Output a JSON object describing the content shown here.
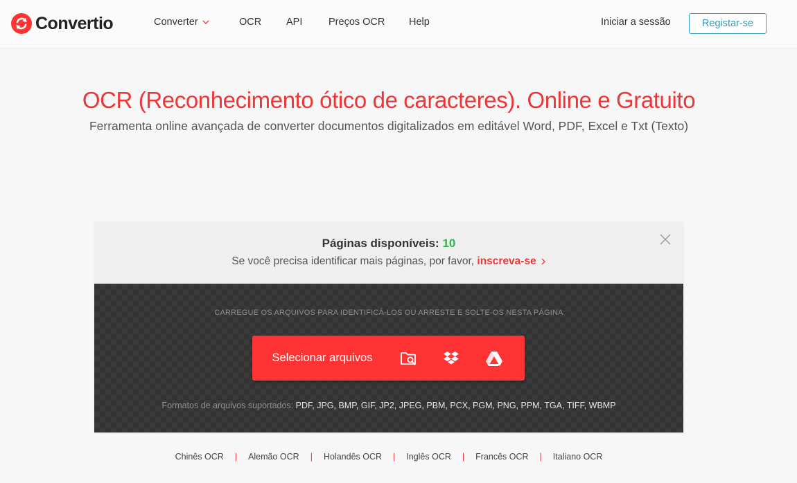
{
  "header": {
    "logo_text": "Convertio",
    "nav": {
      "converter": "Converter",
      "ocr": "OCR",
      "api": "API",
      "precos": "Preços OCR",
      "help": "Help"
    },
    "login": "Iniciar a sessão",
    "register": "Registar-se"
  },
  "hero": {
    "title": "OCR (Reconhecimento ótico de caracteres). Online e Gratuito",
    "subtitle": "Ferramenta online avançada de converter documentos digitalizados em editável Word, PDF, Excel e Txt (Texto)"
  },
  "card": {
    "pages_label": "Páginas disponíveis:",
    "pages_count": "10",
    "signup_text": "Se você precisa identificar mais páginas, por favor,",
    "signup_link": "inscreva-se",
    "drop_hint": "CARREGUE OS ARQUIVOS PARA IDENTIFICÁ-LOS OU ARRESTE E SOLTE-OS NESTA PÁGINA",
    "select_label": "Selecionar arquivos",
    "formats_label": "Formatos de arquivos suportados:",
    "formats_list": "PDF, JPG, BMP, GIF, JP2, JPEG, PBM, PCX, PGM, PNG, PPM, TGA, TIFF, WBMP"
  },
  "languages": [
    "Chinês OCR",
    "Alemão OCR",
    "Holandês OCR",
    "Inglês OCR",
    "Francês OCR",
    "Italiano OCR"
  ],
  "icons": {
    "logo": "convertio-logo-icon",
    "converter_dropdown": "chevron-down-icon",
    "close": "close-icon",
    "signup_chevron": "chevron-right-icon",
    "folder": "folder-search-icon",
    "dropbox": "dropbox-icon",
    "drive": "google-drive-icon"
  },
  "colors": {
    "brand_red": "#ff3333",
    "title_red": "#ef3636",
    "accent_blue": "#2f9bbd",
    "count_green": "#2db552",
    "dropzone_dark": "#333333"
  }
}
